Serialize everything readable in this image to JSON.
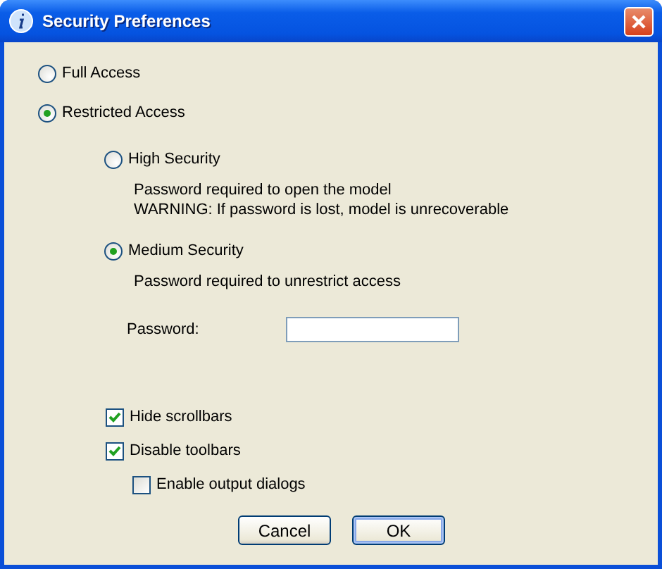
{
  "window": {
    "title": "Security Preferences"
  },
  "access_options": [
    {
      "label": "Full Access",
      "selected": false
    },
    {
      "label": "Restricted Access",
      "selected": true
    }
  ],
  "security_levels": [
    {
      "label": "High Security",
      "selected": false,
      "description": [
        "Password required to open the model",
        "WARNING: If password is lost, model is unrecoverable"
      ]
    },
    {
      "label": "Medium Security",
      "selected": true,
      "description": [
        "Password required to unrestrict access"
      ]
    }
  ],
  "password": {
    "label": "Password:"
  },
  "options": [
    {
      "label": "Hide scrollbars",
      "checked": true
    },
    {
      "label": "Disable toolbars",
      "checked": true,
      "children": [
        {
          "label": "Enable output dialogs",
          "checked": false
        }
      ]
    }
  ],
  "buttons": [
    {
      "label": "Cancel",
      "default": false
    },
    {
      "label": "OK",
      "default": true
    }
  ]
}
